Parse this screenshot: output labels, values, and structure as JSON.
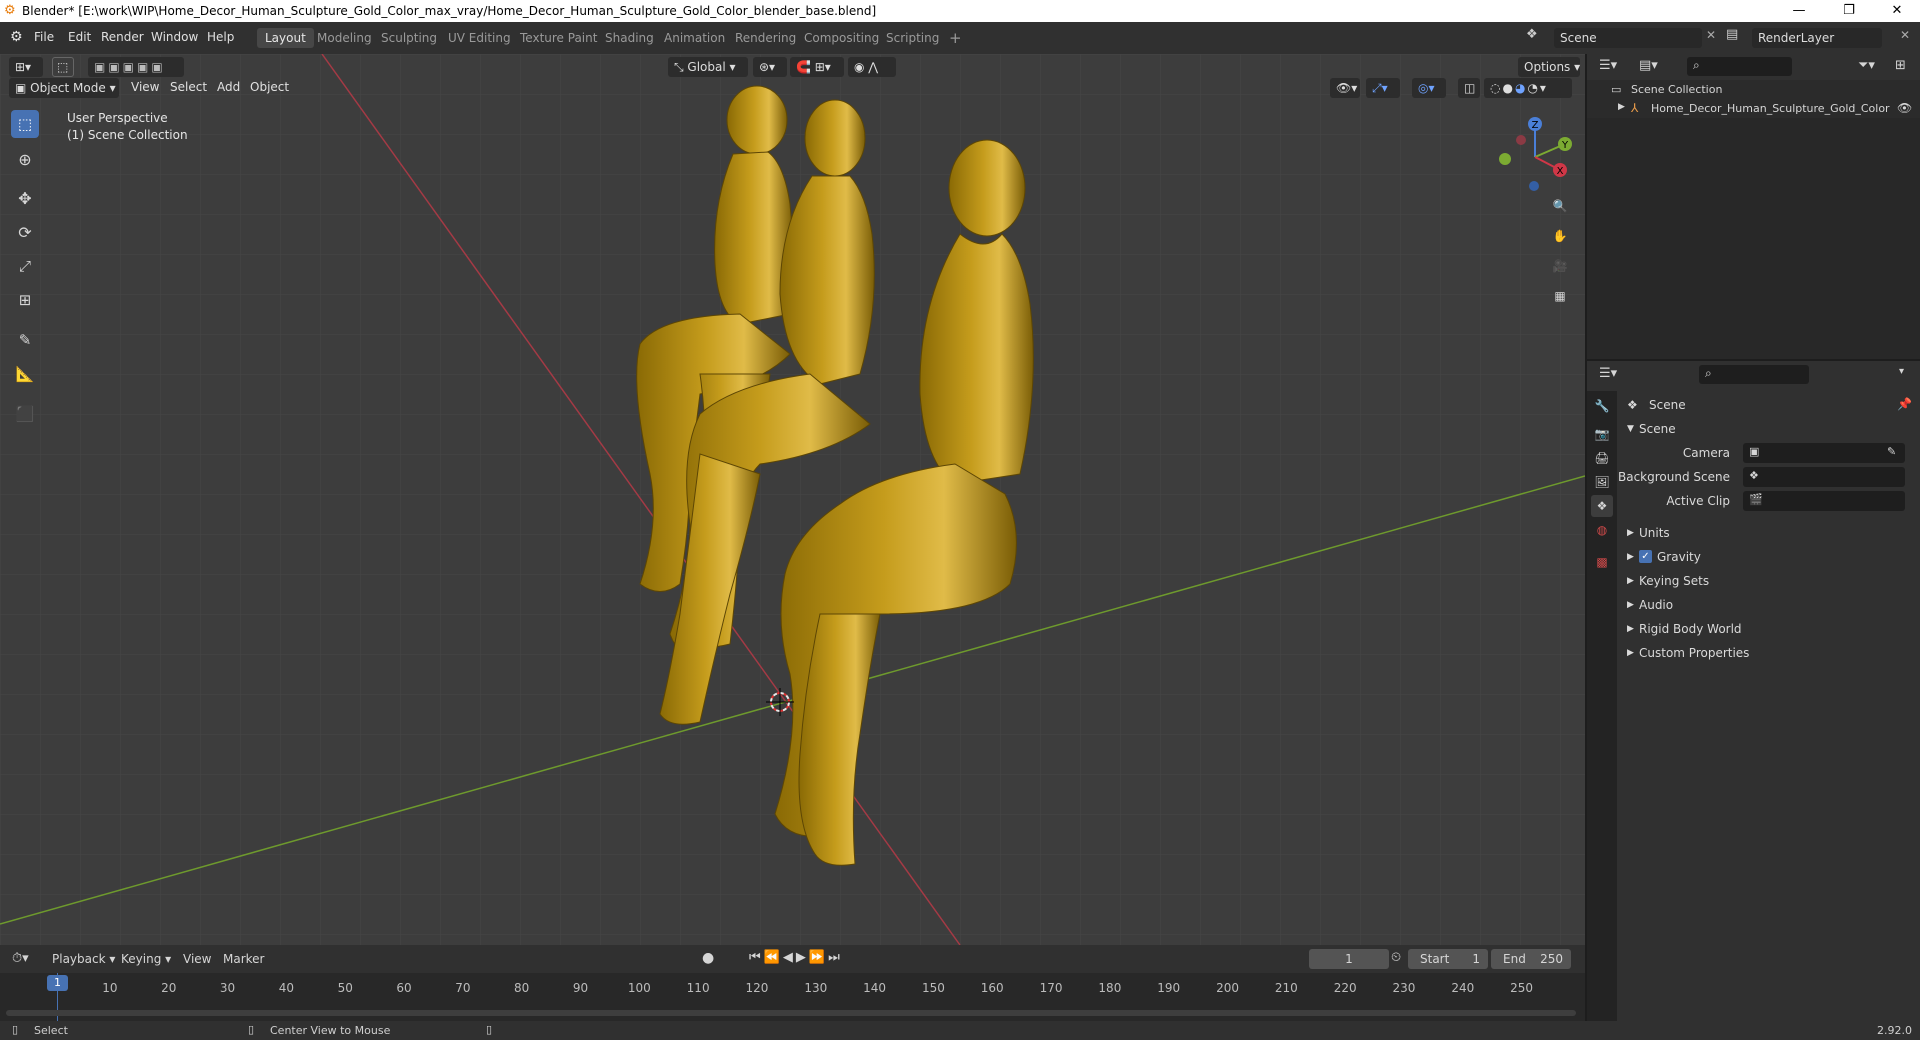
{
  "window": {
    "title": "Blender* [E:\\work\\WIP\\Home_Decor_Human_Sculpture_Gold_Color_max_vray/Home_Decor_Human_Sculpture_Gold_Color_blender_base.blend]",
    "minimize": "—",
    "maximize": "❐",
    "close": "✕"
  },
  "menu": [
    "File",
    "Edit",
    "Render",
    "Window",
    "Help"
  ],
  "workspaces": [
    "Layout",
    "Modeling",
    "Sculpting",
    "UV Editing",
    "Texture Paint",
    "Shading",
    "Animation",
    "Rendering",
    "Compositing",
    "Scripting"
  ],
  "workspace_add": "+",
  "scene_name": "Scene",
  "view_layer": "RenderLayer",
  "viewport": {
    "transform_orientation": "Global",
    "options_label": "Options",
    "mode": "Object Mode",
    "header_menus": [
      "View",
      "Select",
      "Add",
      "Object"
    ],
    "overlay_line1": "User Perspective",
    "overlay_line2": "(1) Scene Collection",
    "gizmo_axes": {
      "z": "Z",
      "y": "Y",
      "x": "X"
    }
  },
  "outliner": {
    "root": "Scene Collection",
    "items": [
      "Home_Decor_Human_Sculpture_Gold_Color"
    ]
  },
  "properties": {
    "context": "Scene",
    "panel": "Scene",
    "fields": [
      {
        "label": "Camera",
        "value": ""
      },
      {
        "label": "Background Scene",
        "value": ""
      },
      {
        "label": "Active Clip",
        "value": ""
      }
    ],
    "subpanels": [
      {
        "label": "Units",
        "checkbox": false
      },
      {
        "label": "Gravity",
        "checkbox": true
      },
      {
        "label": "Keying Sets",
        "checkbox": false
      },
      {
        "label": "Audio",
        "checkbox": false
      },
      {
        "label": "Rigid Body World",
        "checkbox": false
      },
      {
        "label": "Custom Properties",
        "checkbox": false
      }
    ]
  },
  "timeline": {
    "menus": [
      "Playback",
      "Keying",
      "View",
      "Marker"
    ],
    "current_frame": "1",
    "start_label": "Start",
    "start": "1",
    "end_label": "End",
    "end": "250",
    "playhead": "1",
    "ticks": [
      "10",
      "20",
      "30",
      "40",
      "50",
      "60",
      "70",
      "80",
      "90",
      "100",
      "110",
      "120",
      "130",
      "140",
      "150",
      "160",
      "170",
      "180",
      "190",
      "200",
      "210",
      "220",
      "230",
      "240",
      "250"
    ]
  },
  "status": {
    "left": "Select",
    "middle": "Center View to Mouse",
    "version": "2.92.0"
  },
  "colors": {
    "accent": "#4772b3",
    "gold": "#b8900f",
    "x_axis": "#a43a45",
    "y_axis": "#6e9a2d"
  }
}
